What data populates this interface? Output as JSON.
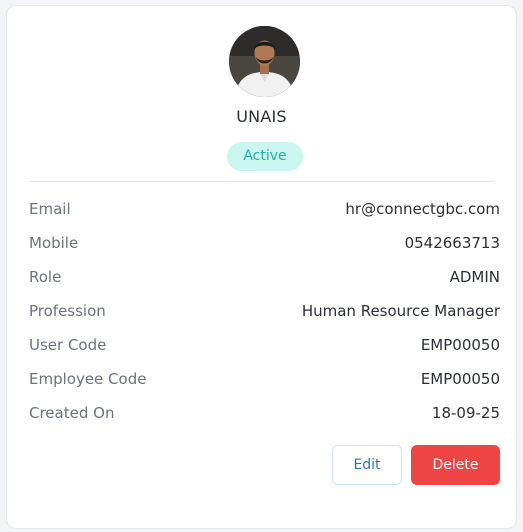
{
  "profile": {
    "name": "UNAIS",
    "status": "Active"
  },
  "details": [
    {
      "label": "Email",
      "value": "hr@connectgbc.com"
    },
    {
      "label": "Mobile",
      "value": "0542663713"
    },
    {
      "label": "Role",
      "value": "ADMIN"
    },
    {
      "label": "Profession",
      "value": "Human Resource Manager"
    },
    {
      "label": "User Code",
      "value": "EMP00050"
    },
    {
      "label": "Employee Code",
      "value": "EMP00050"
    },
    {
      "label": "Created On",
      "value": "18-09-25"
    }
  ],
  "actions": {
    "edit_label": "Edit",
    "delete_label": "Delete"
  },
  "colors": {
    "status_bg": "#c9f6ef",
    "status_text": "#21b3a2",
    "edit_text": "#2f6ed8",
    "delete_bg": "#ef4444"
  }
}
